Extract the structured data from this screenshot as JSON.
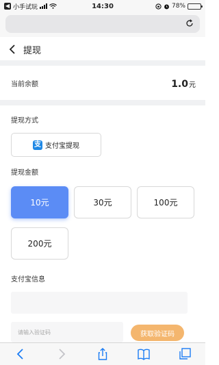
{
  "status_bar": {
    "back_app_glyph": "◀",
    "carrier": "小手试玩",
    "time": "14:30",
    "battery": "78%",
    "battery_level": 0.78
  },
  "header": {
    "title": "提现"
  },
  "balance": {
    "label": "当前余额",
    "value": "1.0",
    "unit": "元"
  },
  "withdraw_method": {
    "label": "提现方式",
    "option_label": "支付宝提现",
    "icon_glyph": "支"
  },
  "withdraw_amount": {
    "label": "提现金额",
    "options": [
      {
        "label": "10元",
        "selected": true
      },
      {
        "label": "30元",
        "selected": false
      },
      {
        "label": "100元",
        "selected": false
      },
      {
        "label": "200元",
        "selected": false
      }
    ]
  },
  "alipay_info": {
    "label": "支付宝信息",
    "code_placeholder": "请输入验证码",
    "get_code_label": "获取验证码"
  },
  "colors": {
    "accent": "#5b8cf5",
    "code_button": "#f4b66e",
    "browser_blue": "#1a7cf4"
  },
  "icons": {
    "reload": "reload-icon",
    "back": "chevron-left-icon",
    "toolbar": [
      "back-icon",
      "forward-icon",
      "share-icon",
      "bookmarks-icon",
      "tabs-icon"
    ]
  }
}
